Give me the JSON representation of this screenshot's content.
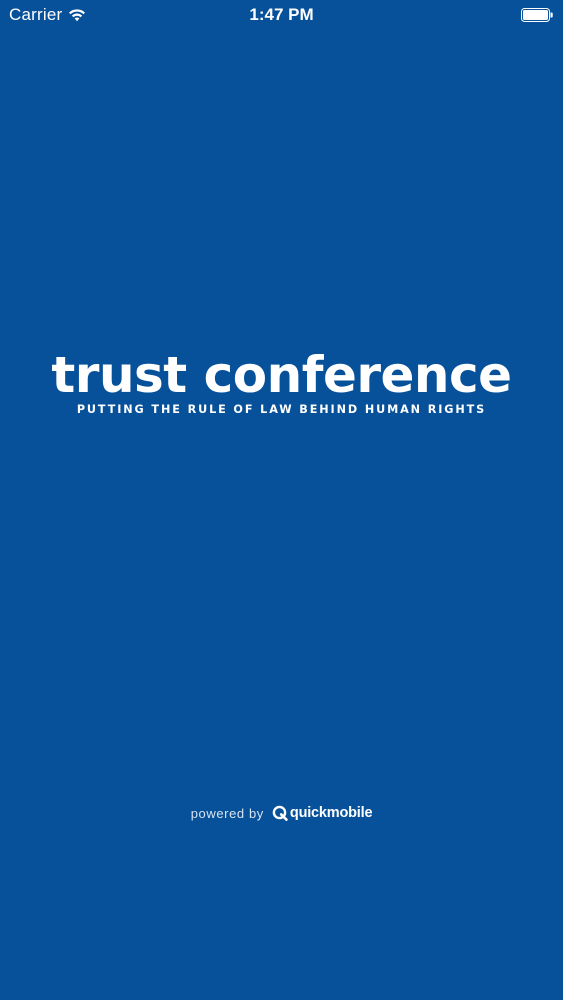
{
  "status_bar": {
    "carrier": "Carrier",
    "wifi_icon": "wifi-icon",
    "time": "1:47 PM",
    "battery_icon": "battery-full-icon"
  },
  "splash": {
    "title": "trust conference",
    "tagline": "PUTTING THE RULE OF LAW BEHIND HUMAN RIGHTS"
  },
  "footer": {
    "powered_label": "powered by",
    "brand_icon": "quickmobile-logo-icon",
    "brand_name": "quickmobile"
  },
  "colors": {
    "background": "#06519a",
    "text": "#ffffff"
  }
}
